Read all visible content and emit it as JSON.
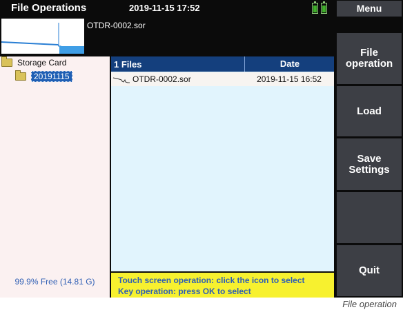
{
  "header": {
    "title": "File Operations",
    "datetime": "2019-11-15 17:52",
    "battery_icons": [
      "battery-icon",
      "battery-icon"
    ]
  },
  "preview": {
    "filename": "OTDR-0002.sor"
  },
  "side_menu": {
    "heading": "Menu",
    "buttons": [
      {
        "label": "File operation"
      },
      {
        "label": "Load"
      },
      {
        "label": "Save Settings"
      },
      {
        "label": ""
      },
      {
        "label": "Quit"
      }
    ]
  },
  "tree": {
    "root": "Storage Card",
    "child": "20191115",
    "free_space": "99.9% Free (14.81 G)"
  },
  "file_table": {
    "count_header": "1 Files",
    "date_header": "Date",
    "rows": [
      {
        "name": "OTDR-0002.sor",
        "date": "2019-11-15 16:52",
        "icon": "trace-icon"
      }
    ]
  },
  "hint": {
    "line1": "Touch screen operation: click the icon to select",
    "line2": "Key operation: press OK to select"
  },
  "caption": "File operation",
  "colors": {
    "header_blue": "#143f7d",
    "selection_blue": "#1f5fb4",
    "hint_yellow": "#f7f12f",
    "button_gray": "#3d3f45"
  }
}
